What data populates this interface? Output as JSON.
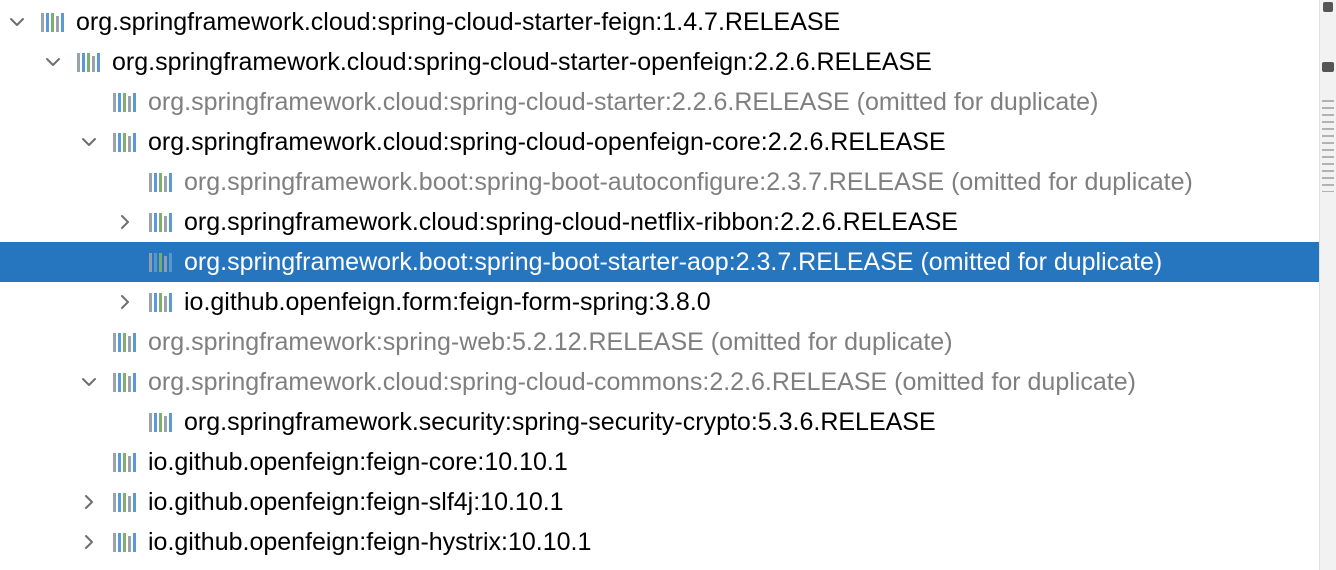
{
  "colors": {
    "selection": "#2675bf",
    "muted_text": "#7f7f7f",
    "icon_bar_1": "#5a9bd5",
    "icon_bar_2": "#7fb06a",
    "icon_bar_3": "#9aa3ad"
  },
  "tree": {
    "nodes": [
      {
        "label": "org.springframework.cloud:spring-cloud-starter-feign:1.4.7.RELEASE",
        "depth": 0,
        "toggle": "expanded",
        "muted": false,
        "selected": false,
        "icon": "library-icon"
      },
      {
        "label": "org.springframework.cloud:spring-cloud-starter-openfeign:2.2.6.RELEASE",
        "depth": 1,
        "toggle": "expanded",
        "muted": false,
        "selected": false,
        "icon": "library-icon"
      },
      {
        "label": "org.springframework.cloud:spring-cloud-starter:2.2.6.RELEASE (omitted for duplicate)",
        "depth": 2,
        "toggle": "none",
        "muted": true,
        "selected": false,
        "icon": "library-icon"
      },
      {
        "label": "org.springframework.cloud:spring-cloud-openfeign-core:2.2.6.RELEASE",
        "depth": 2,
        "toggle": "expanded",
        "muted": false,
        "selected": false,
        "icon": "library-icon"
      },
      {
        "label": "org.springframework.boot:spring-boot-autoconfigure:2.3.7.RELEASE (omitted for duplicate)",
        "depth": 3,
        "toggle": "none",
        "muted": true,
        "selected": false,
        "icon": "library-icon"
      },
      {
        "label": "org.springframework.cloud:spring-cloud-netflix-ribbon:2.2.6.RELEASE",
        "depth": 3,
        "toggle": "collapsed",
        "muted": false,
        "selected": false,
        "icon": "library-icon"
      },
      {
        "label": "org.springframework.boot:spring-boot-starter-aop:2.3.7.RELEASE (omitted for duplicate)",
        "depth": 3,
        "toggle": "none",
        "muted": false,
        "selected": true,
        "icon": "library-icon"
      },
      {
        "label": "io.github.openfeign.form:feign-form-spring:3.8.0",
        "depth": 3,
        "toggle": "collapsed",
        "muted": false,
        "selected": false,
        "icon": "library-icon"
      },
      {
        "label": "org.springframework:spring-web:5.2.12.RELEASE (omitted for duplicate)",
        "depth": 2,
        "toggle": "none",
        "muted": true,
        "selected": false,
        "icon": "library-icon"
      },
      {
        "label": "org.springframework.cloud:spring-cloud-commons:2.2.6.RELEASE (omitted for duplicate)",
        "depth": 2,
        "toggle": "expanded",
        "muted": true,
        "selected": false,
        "icon": "library-icon"
      },
      {
        "label": "org.springframework.security:spring-security-crypto:5.3.6.RELEASE",
        "depth": 3,
        "toggle": "none",
        "muted": false,
        "selected": false,
        "icon": "library-icon"
      },
      {
        "label": "io.github.openfeign:feign-core:10.10.1",
        "depth": 2,
        "toggle": "none",
        "muted": false,
        "selected": false,
        "icon": "library-icon"
      },
      {
        "label": "io.github.openfeign:feign-slf4j:10.10.1",
        "depth": 2,
        "toggle": "collapsed",
        "muted": false,
        "selected": false,
        "icon": "library-icon"
      },
      {
        "label": "io.github.openfeign:feign-hystrix:10.10.1",
        "depth": 2,
        "toggle": "collapsed",
        "muted": false,
        "selected": false,
        "icon": "library-icon"
      }
    ]
  }
}
